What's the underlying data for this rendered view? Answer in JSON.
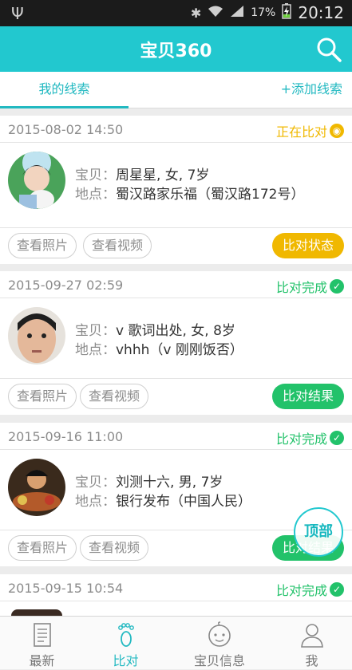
{
  "status_bar": {
    "battery": "17%",
    "time": "20:12"
  },
  "app_bar": {
    "title": "宝贝360",
    "search_icon": "search-icon"
  },
  "tabs": {
    "mine": "我的线索",
    "add": "+添加线索"
  },
  "cards": [
    {
      "date": "2015-08-02 14:50",
      "status": "正在比对",
      "status_icon": "eye-icon",
      "status_color": "#f0b800",
      "baby_label": "宝贝：",
      "baby": "周星星, 女, 7岁",
      "place_label": "地点：",
      "place": "蜀汉路家乐福（蜀汉路172号）",
      "photo_btn": "查看照片",
      "video_btn": "查看视频",
      "action": "比对状态",
      "action_color": "#f0b800"
    },
    {
      "date": "2015-09-27 02:59",
      "status": "比对完成",
      "status_icon": "check-icon",
      "status_color": "#22c26a",
      "baby_label": "宝贝：",
      "baby": "v 歌词出处, 女, 8岁",
      "place_label": "地点：",
      "place": "vhhh（v 刚刚饭否）",
      "photo_btn": "查看照片",
      "video_btn": "查看视频",
      "action": "比对结果",
      "action_color": "#22c26a"
    },
    {
      "date": "2015-09-16 11:00",
      "status": "比对完成",
      "status_icon": "check-icon",
      "status_color": "#22c26a",
      "baby_label": "宝贝：",
      "baby": "刘测十六, 男, 7岁",
      "place_label": "地点：",
      "place": "银行发布（中国人民）",
      "photo_btn": "查看照片",
      "video_btn": "查看视频",
      "action": "比对结果",
      "action_color": "#22c26a"
    },
    {
      "date": "2015-09-15 10:54",
      "status": "比对完成",
      "status_icon": "check-icon",
      "status_color": "#22c26a"
    }
  ],
  "fab": {
    "label": "顶部"
  },
  "bottom_nav": [
    {
      "label": "最新",
      "icon": "newspaper-icon"
    },
    {
      "label": "比对",
      "icon": "footprint-icon",
      "active": true
    },
    {
      "label": "宝贝信息",
      "icon": "baby-face-icon"
    },
    {
      "label": "我",
      "icon": "person-icon"
    }
  ]
}
